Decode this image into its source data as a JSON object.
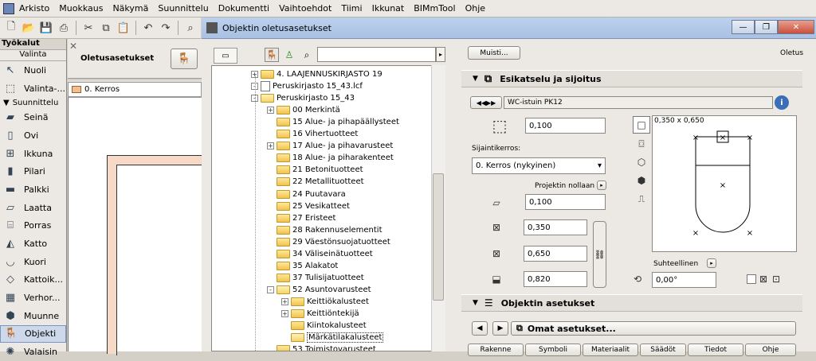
{
  "menubar": {
    "items": [
      "Arkisto",
      "Muokkaus",
      "Näkymä",
      "Suunnittelu",
      "Dokumentti",
      "Vaihtoehdot",
      "Tiimi",
      "Ikkunat",
      "BIMmTool",
      "Ohje"
    ]
  },
  "toolbox": {
    "title": "Työkalut",
    "valinta": "Valinta",
    "items": [
      {
        "label": "Nuoli",
        "icon": "arrow-icon"
      },
      {
        "label": "Valinta-...",
        "icon": "marquee-icon"
      },
      {
        "label": "Suunnittelu",
        "icon": "triangle-icon",
        "group": true
      },
      {
        "label": "Seinä",
        "icon": "wall-icon"
      },
      {
        "label": "Ovi",
        "icon": "door-icon"
      },
      {
        "label": "Ikkuna",
        "icon": "window-icon"
      },
      {
        "label": "Pilari",
        "icon": "column-icon"
      },
      {
        "label": "Palkki",
        "icon": "beam-icon"
      },
      {
        "label": "Laatta",
        "icon": "slab-icon"
      },
      {
        "label": "Porras",
        "icon": "stair-icon"
      },
      {
        "label": "Katto",
        "icon": "roof-icon"
      },
      {
        "label": "Kuori",
        "icon": "shell-icon"
      },
      {
        "label": "Kattoik...",
        "icon": "skylight-icon"
      },
      {
        "label": "Verhor...",
        "icon": "curtainwall-icon"
      },
      {
        "label": "Muunne",
        "icon": "morph-icon"
      },
      {
        "label": "Objekti",
        "icon": "object-icon",
        "selected": true
      },
      {
        "label": "Valaisin",
        "icon": "lamp-icon"
      }
    ]
  },
  "infobox": {
    "title": "Oletusasetukset"
  },
  "tab": {
    "label": "0. Kerros"
  },
  "dialog": {
    "title": "Objektin oletusasetukset"
  },
  "tree": {
    "rows": [
      {
        "label": "4. LAAJENNUSKIRJASTO 19",
        "indent": 0,
        "pm": "+",
        "icon": "folder"
      },
      {
        "label": "Peruskirjasto 15_43.lcf",
        "indent": 0,
        "pm": "-",
        "icon": "file"
      },
      {
        "label": "Peruskirjasto 15_43",
        "indent": 1,
        "pm": "-",
        "icon": "folder-open"
      },
      {
        "label": "00 Merkintä",
        "indent": 2,
        "pm": "+",
        "icon": "folder"
      },
      {
        "label": "15 Alue- ja pihapäällysteet",
        "indent": 2,
        "pm": "",
        "icon": "folder"
      },
      {
        "label": "16 Vihertuotteet",
        "indent": 2,
        "pm": "",
        "icon": "folder"
      },
      {
        "label": "17 Alue- ja pihavarusteet",
        "indent": 2,
        "pm": "+",
        "icon": "folder"
      },
      {
        "label": "18 Alue- ja piharakenteet",
        "indent": 2,
        "pm": "",
        "icon": "folder"
      },
      {
        "label": "21 Betonituotteet",
        "indent": 2,
        "pm": "",
        "icon": "folder"
      },
      {
        "label": "22 Metallituotteet",
        "indent": 2,
        "pm": "",
        "icon": "folder"
      },
      {
        "label": "24 Puutavara",
        "indent": 2,
        "pm": "",
        "icon": "folder"
      },
      {
        "label": "25 Vesikatteet",
        "indent": 2,
        "pm": "",
        "icon": "folder"
      },
      {
        "label": "27 Eristeet",
        "indent": 2,
        "pm": "",
        "icon": "folder"
      },
      {
        "label": "28 Rakennuselementit",
        "indent": 2,
        "pm": "",
        "icon": "folder"
      },
      {
        "label": "29 Väestönsuojatuotteet",
        "indent": 2,
        "pm": "",
        "icon": "folder"
      },
      {
        "label": "34 Väliseinätuotteet",
        "indent": 2,
        "pm": "",
        "icon": "folder"
      },
      {
        "label": "35 Alakatot",
        "indent": 2,
        "pm": "",
        "icon": "folder"
      },
      {
        "label": "37 Tulisijatuotteet",
        "indent": 2,
        "pm": "",
        "icon": "folder"
      },
      {
        "label": "52 Asuntovarusteet",
        "indent": 2,
        "pm": "-",
        "icon": "folder-open"
      },
      {
        "label": "Keittiökalusteet",
        "indent": 3,
        "pm": "+",
        "icon": "folder"
      },
      {
        "label": "Keittiöntekijä",
        "indent": 3,
        "pm": "+",
        "icon": "folder"
      },
      {
        "label": "Kiintokalusteet",
        "indent": 3,
        "pm": "",
        "icon": "folder"
      },
      {
        "label": "Märkätilakalusteet",
        "indent": 3,
        "pm": "",
        "icon": "folder-open",
        "selected": true
      },
      {
        "label": "53 Toimistovarusteet",
        "indent": 2,
        "pm": "",
        "icon": "folder"
      }
    ]
  },
  "settings": {
    "muisti": "Muisti...",
    "oletus": "Oletus",
    "section1": "Esikatselu ja sijoitus",
    "object_name": "WC-istuin PK12",
    "height_top": "0,100",
    "sijaintikerros_label": "Sijaintikerros:",
    "sijaintikerros_value": "0. Kerros (nykyinen)",
    "projektin_nollaan": "Projektin nollaan",
    "elevation": "0,100",
    "width": "0,350",
    "depth": "0,650",
    "height": "0,820",
    "preview_size": "0,350 x 0,650",
    "suhteellinen": "Suhteellinen",
    "angle": "0,00°",
    "section2": "Objektin asetukset",
    "omat_asetukset": "Omat asetukset...",
    "bottom_tabs": [
      "Rakenne",
      "Symboli",
      "Materiaalit",
      "Säädöt",
      "Tiedot",
      "Ohje"
    ]
  }
}
